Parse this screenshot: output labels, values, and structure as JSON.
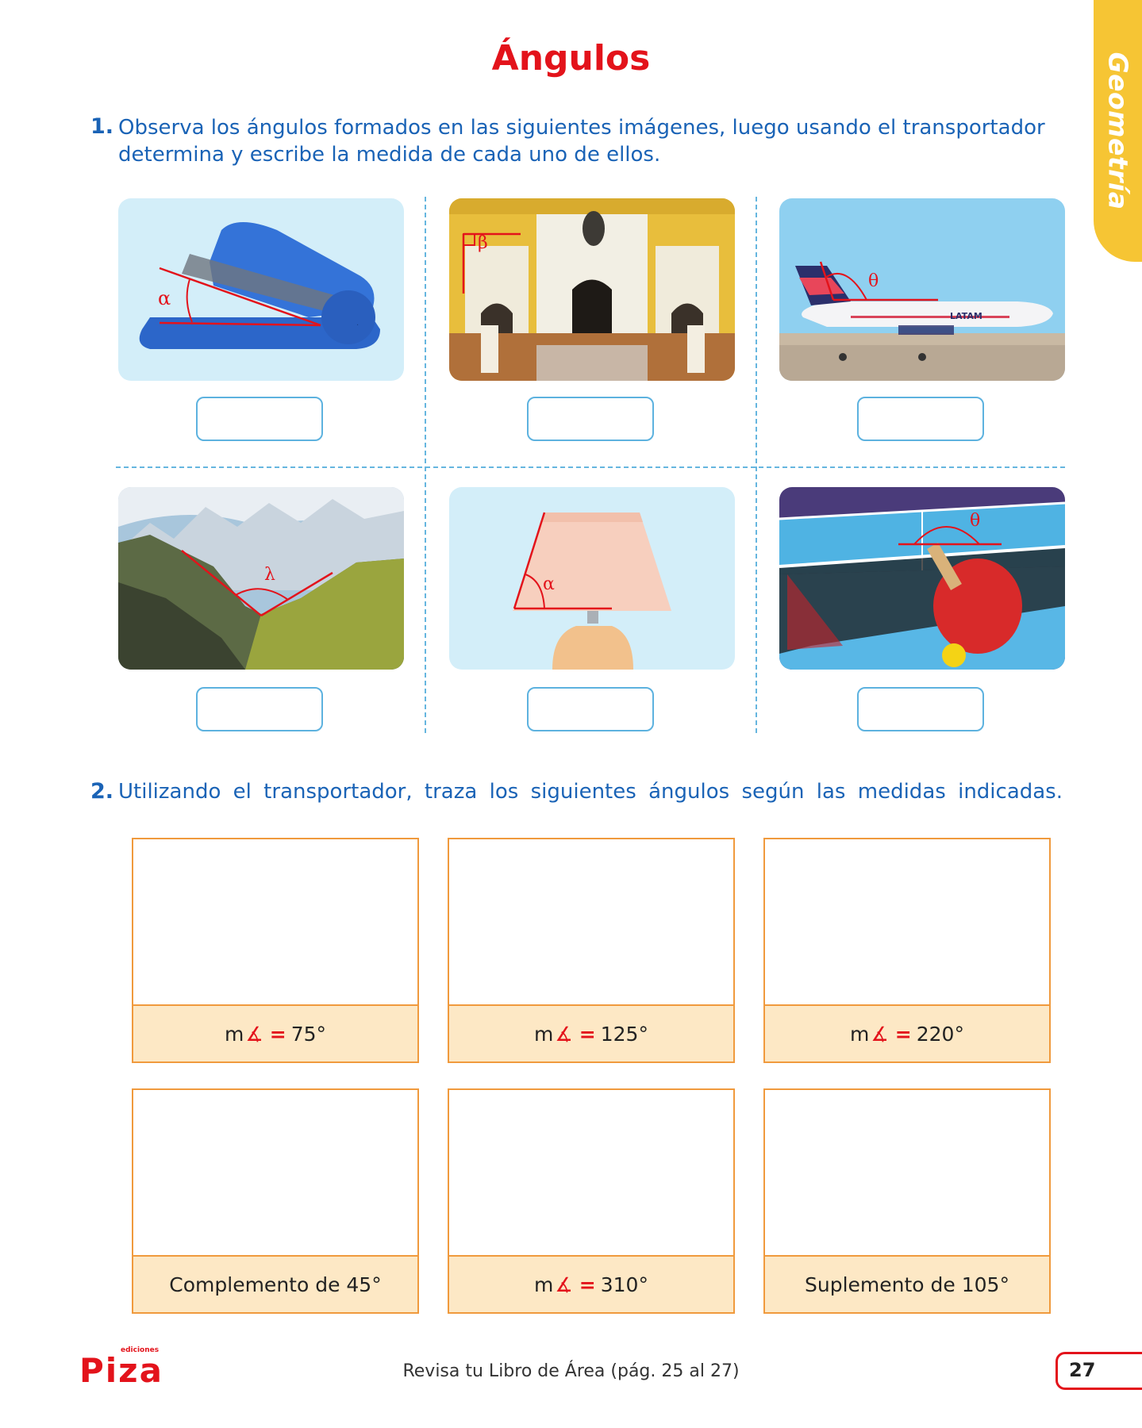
{
  "side_tab": {
    "label": "Geometría"
  },
  "title": "Ángulos",
  "exercise1": {
    "number": "1.",
    "instruction_line1": "Observa los ángulos formados en las siguientes imágenes, luego usando el transportador",
    "instruction_line2": "determina y escribe la medida de cada uno de ellos.",
    "images": [
      {
        "subject": "stapler",
        "angle_symbol": "α"
      },
      {
        "subject": "cathedral facade",
        "angle_symbol": "β"
      },
      {
        "subject": "airplane",
        "angle_symbol": "θ",
        "livery_text": "LATAM"
      },
      {
        "subject": "mountains",
        "angle_symbol": "λ"
      },
      {
        "subject": "lamp",
        "angle_symbol": "α"
      },
      {
        "subject": "ping pong table",
        "angle_symbol": "θ"
      }
    ]
  },
  "exercise2": {
    "number": "2.",
    "instruction": "Utilizando el transportador, traza los siguientes ángulos según las medidas indicadas.",
    "measure_prefix": "m",
    "angle_glyph": "∡",
    "equals": "=",
    "boxes": [
      {
        "value": "75°"
      },
      {
        "value": "125°"
      },
      {
        "value": "220°"
      },
      {
        "text": "Complemento de 45°"
      },
      {
        "value": "310°"
      },
      {
        "text": "Suplemento de 105°"
      }
    ]
  },
  "footer": {
    "logo_small": "ediciones",
    "logo": "Piza",
    "note": "Revisa tu Libro de Área (pág. 25 al 27)",
    "page_number": "27"
  },
  "colors": {
    "title": "#e3131b",
    "instruction": "#1a63b6",
    "dashed_lines": "#66b6df",
    "side_tab": "#f6c534",
    "box_border": "#f09a3d",
    "box_label_bg": "#fde8c5"
  }
}
